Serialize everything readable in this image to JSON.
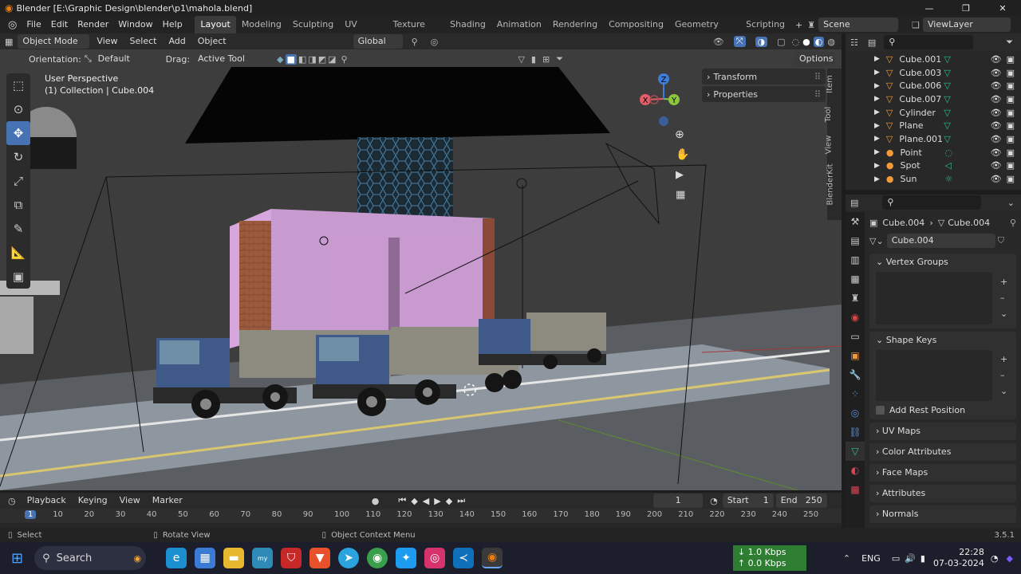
{
  "title": "Blender [E:\\Graphic Design\\blender\\p1\\mahola.blend]",
  "menu": [
    "File",
    "Edit",
    "Render",
    "Window",
    "Help"
  ],
  "workspaces": [
    "Layout",
    "Modeling",
    "Sculpting",
    "UV Editing",
    "Texture Paint",
    "Shading",
    "Animation",
    "Rendering",
    "Compositing",
    "Geometry Nodes",
    "Scripting"
  ],
  "scene": "Scene",
  "view_layer": "ViewLayer",
  "viewport": {
    "mode": "Object Mode",
    "menus": [
      "View",
      "Select",
      "Add",
      "Object"
    ],
    "transform": "Global",
    "orientation_label": "Orientation:",
    "orientation_value": "Default",
    "drag_label": "Drag:",
    "drag_value": "Active Tool",
    "options": "Options",
    "perspective": "User Perspective",
    "collection": "(1) Collection | Cube.004",
    "n_panels": [
      "Transform",
      "Properties"
    ],
    "side_tabs": [
      "Item",
      "Tool",
      "View",
      "BlenderKit"
    ],
    "axes": [
      "X",
      "Y",
      "Z"
    ]
  },
  "outliner": {
    "items": [
      {
        "name": "Cube.001",
        "type": "mesh"
      },
      {
        "name": "Cube.003",
        "type": "mesh"
      },
      {
        "name": "Cube.006",
        "type": "mesh"
      },
      {
        "name": "Cube.007",
        "type": "mesh"
      },
      {
        "name": "Cylinder",
        "type": "mesh"
      },
      {
        "name": "Plane",
        "type": "mesh"
      },
      {
        "name": "Plane.001",
        "type": "mesh"
      },
      {
        "name": "Point",
        "type": "light"
      },
      {
        "name": "Spot",
        "type": "light"
      },
      {
        "name": "Sun",
        "type": "light"
      }
    ]
  },
  "properties": {
    "breadcrumb_object": "Cube.004",
    "breadcrumb_mesh": "Cube.004",
    "data_name": "Cube.004",
    "panels": {
      "vertex_groups": "Vertex Groups",
      "shape_keys": "Shape Keys",
      "add_rest_position": "Add Rest Position",
      "uv_maps": "UV Maps",
      "color_attributes": "Color Attributes",
      "face_maps": "Face Maps",
      "attributes": "Attributes",
      "normals": "Normals"
    }
  },
  "timeline": {
    "menus": [
      "Playback",
      "Keying",
      "View",
      "Marker"
    ],
    "current_frame": "1",
    "start_label": "Start",
    "start": "1",
    "end_label": "End",
    "end": "250",
    "ticks": [
      "1",
      "10",
      "20",
      "30",
      "40",
      "50",
      "60",
      "70",
      "80",
      "90",
      "100",
      "110",
      "120",
      "130",
      "140",
      "150",
      "160",
      "170",
      "180",
      "190",
      "200",
      "210",
      "220",
      "230",
      "240",
      "250"
    ]
  },
  "status": {
    "select": "Select",
    "rotate": "Rotate View",
    "context": "Object Context Menu",
    "version": "3.5.1"
  },
  "taskbar": {
    "search": "Search",
    "net_down": "↓ 1.0 Kbps",
    "net_up": "↑ 0.0 Kbps",
    "lang": "ENG",
    "time": "22:28",
    "date": "07-03-2024"
  }
}
